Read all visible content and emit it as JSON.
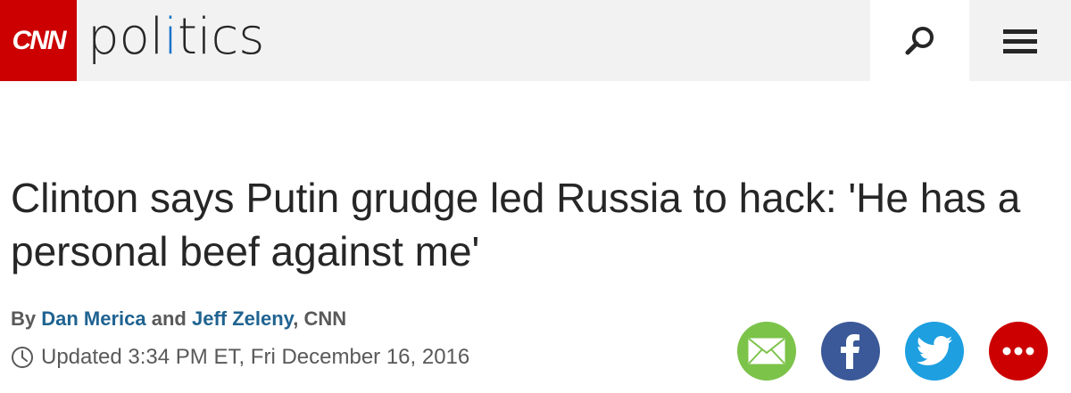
{
  "header": {
    "brand_logo_text": "CNN",
    "section_name": {
      "prefix": "pol",
      "accent": "i",
      "suffix": "tics"
    },
    "colors": {
      "brand": "#cc0000",
      "section_accent": "#1a73c9"
    }
  },
  "article": {
    "headline": "Clinton says Putin grudge led Russia to hack: 'He has a personal beef against me'",
    "byline": {
      "prefix": "By ",
      "author1": "Dan Merica",
      "conjunction": " and ",
      "author2": "Jeff Zeleny",
      "suffix": ", CNN"
    },
    "updated": "Updated 3:34 PM ET, Fri December 16, 2016"
  },
  "share": {
    "buttons": [
      "email-icon",
      "facebook-icon",
      "twitter-icon",
      "more-icon"
    ],
    "colors": {
      "email": "#7cc34a",
      "facebook": "#3b5998",
      "twitter": "#1d9fe0",
      "more": "#cc0000"
    }
  }
}
